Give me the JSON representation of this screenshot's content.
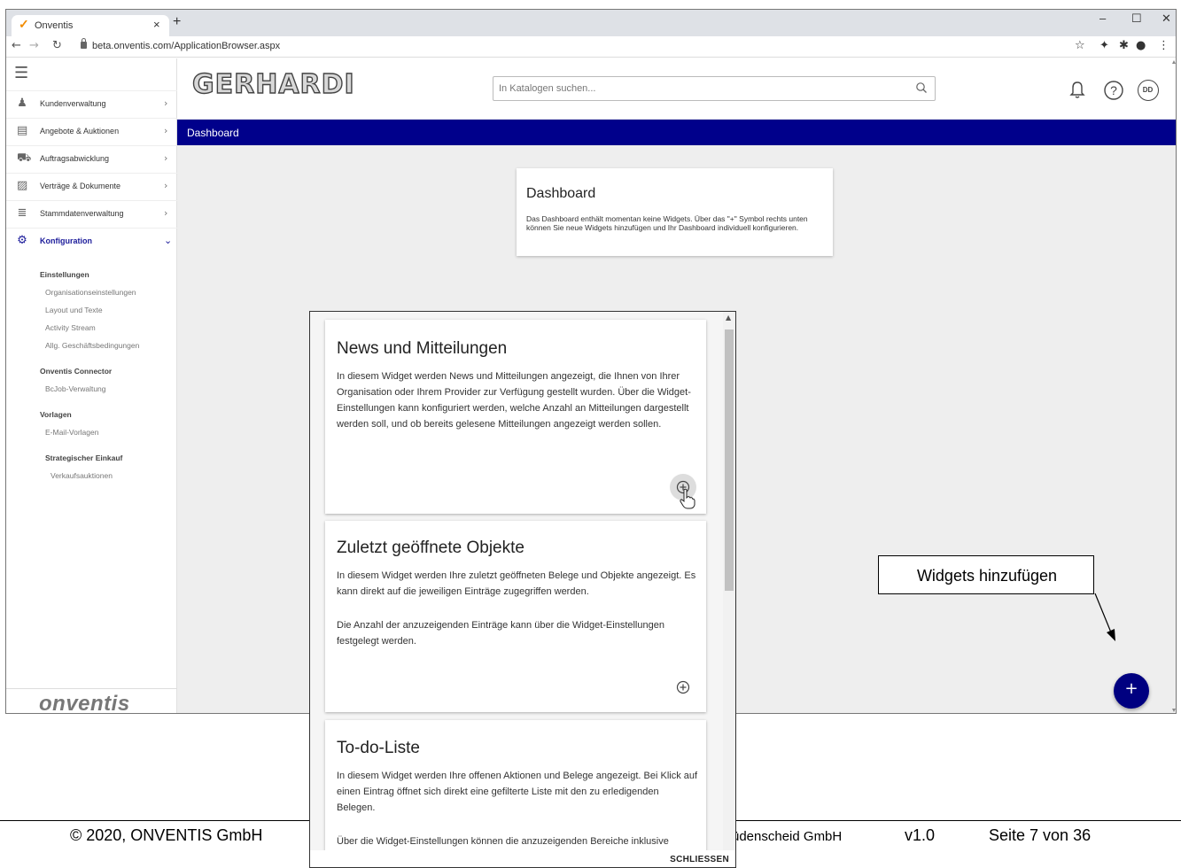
{
  "browser": {
    "tab_title": "Onventis",
    "tab_close": "×",
    "new_tab": "+",
    "url": "beta.onventis.com/ApplicationBrowser.aspx"
  },
  "sidebar": {
    "items": [
      {
        "label": "Kundenverwaltung",
        "icon": "person-icon"
      },
      {
        "label": "Angebote & Auktionen",
        "icon": "clipboard-icon"
      },
      {
        "label": "Auftragsabwicklung",
        "icon": "cart-icon"
      },
      {
        "label": "Verträge & Dokumente",
        "icon": "document-icon"
      },
      {
        "label": "Stammdatenverwaltung",
        "icon": "database-icon"
      },
      {
        "label": "Konfiguration",
        "icon": "gear-icon"
      }
    ],
    "sub_einstellungen": "Einstellungen",
    "sub_items_1": [
      "Organisationseinstellungen",
      "Layout und Texte",
      "Activity Stream",
      "Allg. Geschäftsbedingungen"
    ],
    "sub_connector": "Onventis Connector",
    "sub_items_2": [
      "BcJob-Verwaltung"
    ],
    "sub_vorlagen": "Vorlagen",
    "sub_items_3": [
      "E-Mail-Vorlagen"
    ],
    "sub_strategisch": "Strategischer Einkauf",
    "sub_items_4": [
      "Verkaufsauktionen"
    ],
    "logo": "onventis"
  },
  "header": {
    "brand": "GERHARDI",
    "search_placeholder": "In Katalogen suchen...",
    "avatar": "DD"
  },
  "page": {
    "title": "Dashboard"
  },
  "dashboard_card": {
    "title": "Dashboard",
    "text": "Das Dashboard enthält momentan keine Widgets. Über das \"+\" Symbol rechts unten können Sie neue Widgets hinzufügen und Ihr Dashboard individuell konfigurieren."
  },
  "fab": {
    "label": "+"
  },
  "callout": {
    "text": "Widgets hinzufügen"
  },
  "dialog": {
    "widgets": [
      {
        "title": "News und Mitteilungen",
        "text": "In diesem Widget werden News und Mitteilungen angezeigt, die Ihnen von Ihrer Organisation oder Ihrem Provider zur Verfügung gestellt wurden. Über die Widget-Einstellungen kann konfiguriert werden, welche Anzahl an Mitteilungen dargestellt werden soll, und ob bereits gelesene Mitteilungen angezeigt werden sollen."
      },
      {
        "title": "Zuletzt geöffnete Objekte",
        "text": "In diesem Widget werden Ihre zuletzt geöffneten Belege und Objekte angezeigt. Es kann direkt auf die jeweiligen Einträge zugegriffen werden.",
        "text2": "Die Anzahl der anzuzeigenden Einträge kann über die Widget-Einstellungen festgelegt werden."
      },
      {
        "title": "To-do-Liste",
        "text": "In diesem Widget werden Ihre offenen Aktionen und Belege angezeigt. Bei Klick auf einen Eintrag öffnet sich direkt eine gefilterte Liste mit den zu erledigenden Belegen.",
        "text2": "Über die Widget-Einstellungen können die anzuzeigenden Bereiche inklusive"
      }
    ],
    "close_label": "SCHLIESSEN"
  },
  "doc_footer": {
    "copyright": "© 2020, ONVENTIS GmbH",
    "partial": "üdenscheid GmbH",
    "version": "v1.0",
    "page": "Seite 7 von 36"
  }
}
